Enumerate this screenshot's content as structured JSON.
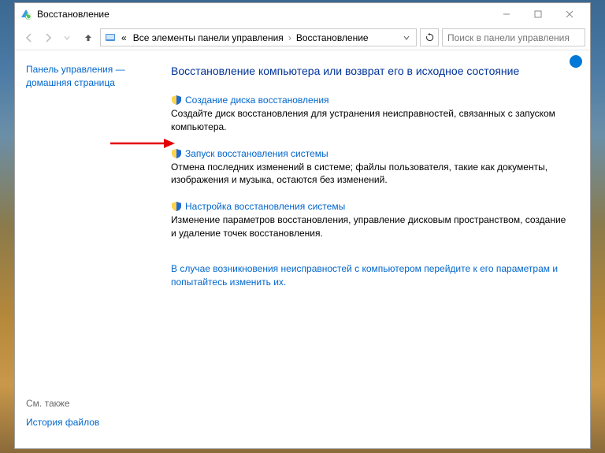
{
  "titlebar": {
    "title": "Восстановление"
  },
  "breadcrumb": {
    "prefix": "«",
    "item1": "Все элементы панели управления",
    "item2": "Восстановление"
  },
  "search": {
    "placeholder": "Поиск в панели управления"
  },
  "sidebar": {
    "cp_home": "Панель управления — домашняя страница",
    "see_also": "См. также",
    "file_history": "История файлов"
  },
  "main": {
    "heading": "Восстановление компьютера или возврат его в исходное состояние",
    "sections": [
      {
        "link": "Создание диска восстановления",
        "desc": "Создайте диск восстановления для устранения неисправностей, связанных с запуском компьютера."
      },
      {
        "link": "Запуск восстановления системы",
        "desc": "Отмена последних изменений в системе; файлы пользователя, такие как документы, изображения и музыка, остаются без изменений."
      },
      {
        "link": "Настройка восстановления системы",
        "desc": "Изменение параметров восстановления, управление дисковым пространством, создание и удаление точек восстановления."
      }
    ],
    "trouble": "В случае возникновения неисправностей с компьютером перейдите к его параметрам и попытайтесь изменить их."
  },
  "help": "?"
}
